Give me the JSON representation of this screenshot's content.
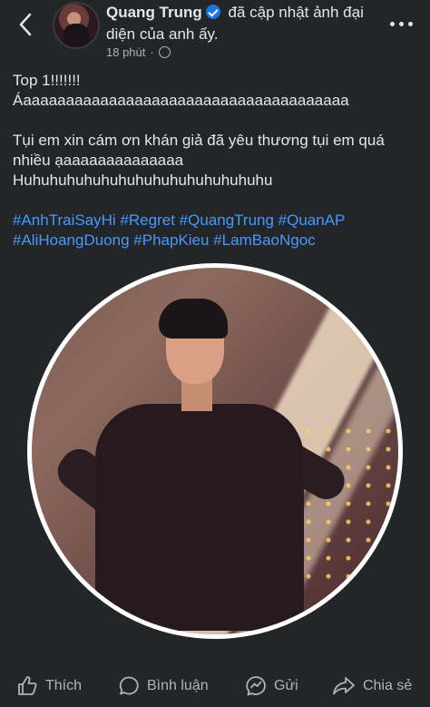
{
  "header": {
    "author": "Quang Trung",
    "action_text": "đã cập nhật ảnh đại diện của anh ấy.",
    "time": "18 phút",
    "separator": "·"
  },
  "post": {
    "lines": [
      "Top 1!!!!!!!",
      "Áaaaaaaaaaaaaaaaaaaaaaaaaaaaaaaaaaaaaaa"
    ],
    "paragraph2": [
      "Tụi em xin cám ơn khán giả đã yêu thương tụi em quá nhiều ạaaaaaaaaaaaaaa",
      "Huhuhuhuhuhuhuhuhuhuhuhuhuhuhu"
    ],
    "hashtags": [
      "#AnhTraiSayHi",
      "#Regret",
      "#QuangTrung",
      "#QuanAP",
      "#AliHoangDuong",
      "#PhapKieu",
      "#LamBaoNgoc"
    ]
  },
  "actions": {
    "like": "Thích",
    "comment": "Bình luận",
    "send": "Gửi",
    "share": "Chia sẻ"
  },
  "icons": {
    "back": "chevron-left-icon",
    "more": "more-horizontal-icon",
    "verified": "verified-badge-icon",
    "privacy": "globe-icon"
  },
  "colors": {
    "background": "#242526",
    "hashtag": "#4599ff",
    "verified": "#1b74e4"
  }
}
